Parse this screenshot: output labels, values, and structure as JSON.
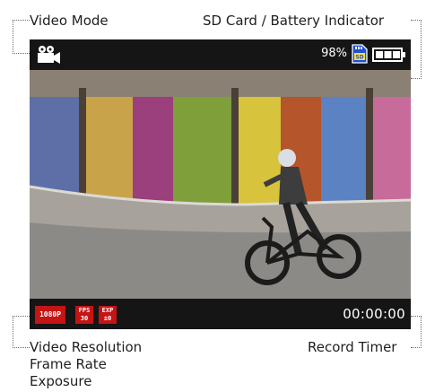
{
  "callouts": {
    "video_mode": "Video Mode",
    "sd_battery": "SD Card / Battery Indicator",
    "resolution_lines": [
      "Video Resolution",
      "Frame Rate",
      "Exposure"
    ],
    "record_timer": "Record Timer"
  },
  "status_bar": {
    "mode_icon": "video-camera-icon",
    "battery_percent": "98%",
    "sd_icon": "sd-card-icon",
    "sd_label": "SD",
    "battery_icon": "battery-icon"
  },
  "bottom_bar": {
    "resolution": "1080P",
    "fps": {
      "label": "FPS",
      "value": "30"
    },
    "exposure": {
      "label": "EXP",
      "value": "±0"
    },
    "timer": "00:00:00"
  },
  "colors": {
    "bar_bg": "#151515",
    "badge_red": "#c41414",
    "sd_blue": "#1e4fd8",
    "text_white": "#ffffff"
  }
}
